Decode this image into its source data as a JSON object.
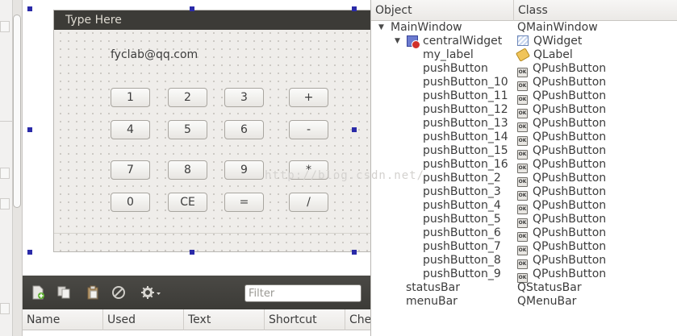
{
  "designer": {
    "menubar_placeholder": "Type Here",
    "email_label": "fyclab@qq.com",
    "buttons": [
      [
        "1",
        "2",
        "3",
        "+"
      ],
      [
        "4",
        "5",
        "6",
        "-"
      ],
      [
        "7",
        "8",
        "9",
        "*"
      ],
      [
        "0",
        "CE",
        "=",
        "/"
      ]
    ],
    "watermark": "http://blog.csdn.net/"
  },
  "action_editor": {
    "toolbar_icons": [
      "new-action-icon",
      "copy-icon",
      "paste-icon",
      "delete-icon",
      "configure-icon"
    ],
    "filter_placeholder": "Filter",
    "columns": [
      "Name",
      "Used",
      "Text",
      "Shortcut",
      "Che"
    ]
  },
  "object_inspector": {
    "columns": [
      "Object",
      "Class"
    ],
    "rows": [
      {
        "object": "MainWindow",
        "class": "QMainWindow",
        "depth": 0,
        "expander": "▼",
        "icon": ""
      },
      {
        "object": "centralWidget",
        "class": "QWidget",
        "depth": 1,
        "expander": "▼",
        "icon": "widget-icon"
      },
      {
        "object": "my_label",
        "class": "QLabel",
        "depth": 2,
        "expander": "",
        "icon": "label-icon"
      },
      {
        "object": "pushButton",
        "class": "QPushButton",
        "depth": 2,
        "expander": "",
        "icon": "pushbutton-icon"
      },
      {
        "object": "pushButton_10",
        "class": "QPushButton",
        "depth": 2,
        "expander": "",
        "icon": "pushbutton-icon"
      },
      {
        "object": "pushButton_11",
        "class": "QPushButton",
        "depth": 2,
        "expander": "",
        "icon": "pushbutton-icon"
      },
      {
        "object": "pushButton_12",
        "class": "QPushButton",
        "depth": 2,
        "expander": "",
        "icon": "pushbutton-icon"
      },
      {
        "object": "pushButton_13",
        "class": "QPushButton",
        "depth": 2,
        "expander": "",
        "icon": "pushbutton-icon"
      },
      {
        "object": "pushButton_14",
        "class": "QPushButton",
        "depth": 2,
        "expander": "",
        "icon": "pushbutton-icon"
      },
      {
        "object": "pushButton_15",
        "class": "QPushButton",
        "depth": 2,
        "expander": "",
        "icon": "pushbutton-icon"
      },
      {
        "object": "pushButton_16",
        "class": "QPushButton",
        "depth": 2,
        "expander": "",
        "icon": "pushbutton-icon"
      },
      {
        "object": "pushButton_2",
        "class": "QPushButton",
        "depth": 2,
        "expander": "",
        "icon": "pushbutton-icon"
      },
      {
        "object": "pushButton_3",
        "class": "QPushButton",
        "depth": 2,
        "expander": "",
        "icon": "pushbutton-icon"
      },
      {
        "object": "pushButton_4",
        "class": "QPushButton",
        "depth": 2,
        "expander": "",
        "icon": "pushbutton-icon"
      },
      {
        "object": "pushButton_5",
        "class": "QPushButton",
        "depth": 2,
        "expander": "",
        "icon": "pushbutton-icon"
      },
      {
        "object": "pushButton_6",
        "class": "QPushButton",
        "depth": 2,
        "expander": "",
        "icon": "pushbutton-icon"
      },
      {
        "object": "pushButton_7",
        "class": "QPushButton",
        "depth": 2,
        "expander": "",
        "icon": "pushbutton-icon"
      },
      {
        "object": "pushButton_8",
        "class": "QPushButton",
        "depth": 2,
        "expander": "",
        "icon": "pushbutton-icon"
      },
      {
        "object": "pushButton_9",
        "class": "QPushButton",
        "depth": 2,
        "expander": "",
        "icon": "pushbutton-icon"
      },
      {
        "object": "statusBar",
        "class": "QStatusBar",
        "depth": 1,
        "expander": "",
        "icon": ""
      },
      {
        "object": "menuBar",
        "class": "QMenuBar",
        "depth": 1,
        "expander": "",
        "icon": ""
      }
    ]
  },
  "colors": {
    "menubar_bg": "#3c3b37",
    "form_bg": "#efedea",
    "selection_handle": "#2a2aa8"
  }
}
